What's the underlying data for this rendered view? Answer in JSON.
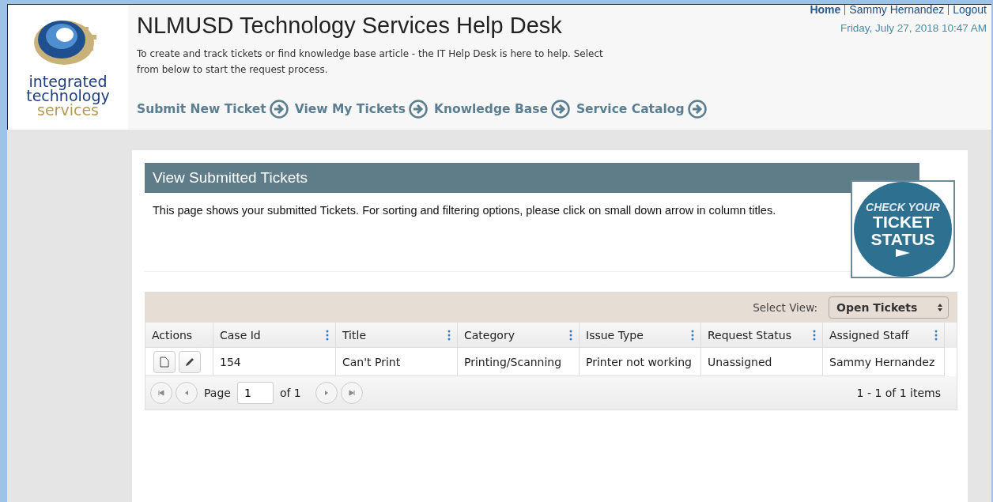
{
  "logo": {
    "lines": [
      "integrated",
      "technology",
      "services"
    ]
  },
  "header": {
    "title": "NLMUSD Technology Services Help Desk",
    "intro": "To create and track tickets or find knowledge base article - the IT Help Desk is here to help. Select from below to start the request process.",
    "nav": [
      "Submit New Ticket",
      "View My Tickets",
      "Knowledge Base",
      "Service Catalog"
    ]
  },
  "top_links": [
    "Home",
    "Sammy Hernandez",
    "Logout"
  ],
  "datetime": "Friday, July 27, 2018 10:47 AM",
  "panel": {
    "title": "View Submitted Tickets",
    "description": "This page shows your submitted Tickets. For sorting and filtering options, please click on small down arrow in column titles.",
    "badge": [
      "CHECK YOUR",
      "TICKET",
      "STATUS"
    ]
  },
  "grid": {
    "select_label": "Select View:",
    "select_value": "Open Tickets",
    "columns": [
      {
        "label": "Actions",
        "menu": false
      },
      {
        "label": "Case Id",
        "menu": true
      },
      {
        "label": "Title",
        "menu": true
      },
      {
        "label": "Category",
        "menu": true
      },
      {
        "label": "Issue Type",
        "menu": true
      },
      {
        "label": "Request Status",
        "menu": true
      },
      {
        "label": "Assigned Staff",
        "menu": true
      }
    ],
    "rows": [
      {
        "cells": [
          "",
          "154",
          "Can't Print",
          "Printing/Scanning",
          "Printer not working",
          "Unassigned",
          "Sammy Hernandez"
        ]
      }
    ],
    "pager": {
      "page_label": "Page",
      "page": "1",
      "of": "of 1",
      "summary": "1 - 1 of 1 items"
    }
  }
}
